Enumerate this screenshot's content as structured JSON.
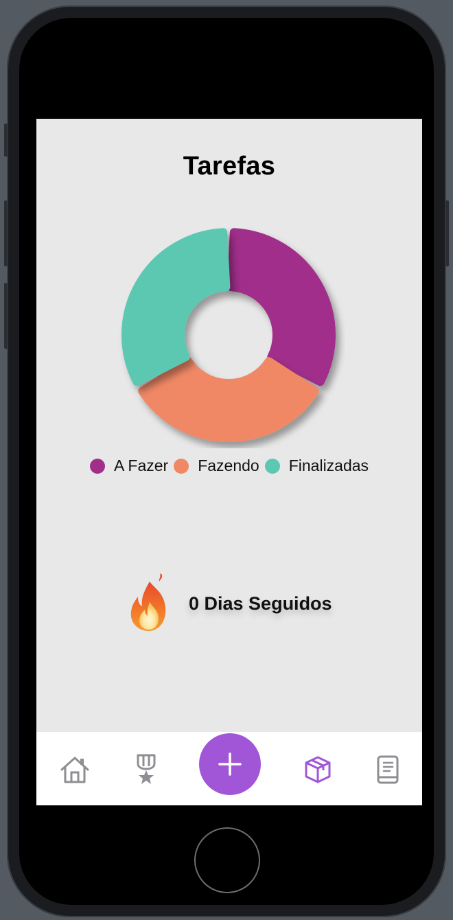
{
  "screen": {
    "title": "Tarefas",
    "background": "#e8e8e8"
  },
  "chart_data": {
    "type": "pie",
    "categories": [
      "A Fazer",
      "Fazendo",
      "Finalizadas"
    ],
    "values": [
      1,
      1,
      1
    ],
    "colors": [
      "#a02f8a",
      "#f08866",
      "#5cc8b1"
    ],
    "title": "",
    "legend_position": "bottom"
  },
  "legend": [
    {
      "label": "A Fazer",
      "color": "#a02f8a"
    },
    {
      "label": "Fazendo",
      "color": "#f08866"
    },
    {
      "label": "Finalizadas",
      "color": "#5cc8b1"
    }
  ],
  "streak": {
    "icon": "flame-icon",
    "text": "0 Dias Seguidos"
  },
  "tabbar": {
    "items": [
      {
        "icon": "home-icon",
        "active": false
      },
      {
        "icon": "medal-icon",
        "active": false
      },
      {
        "icon": "plus-icon",
        "active": false,
        "primary": true
      },
      {
        "icon": "box-icon",
        "active": true
      },
      {
        "icon": "book-icon",
        "active": false
      }
    ],
    "accent": "#a056d6",
    "inactive": "#8e8e93"
  }
}
